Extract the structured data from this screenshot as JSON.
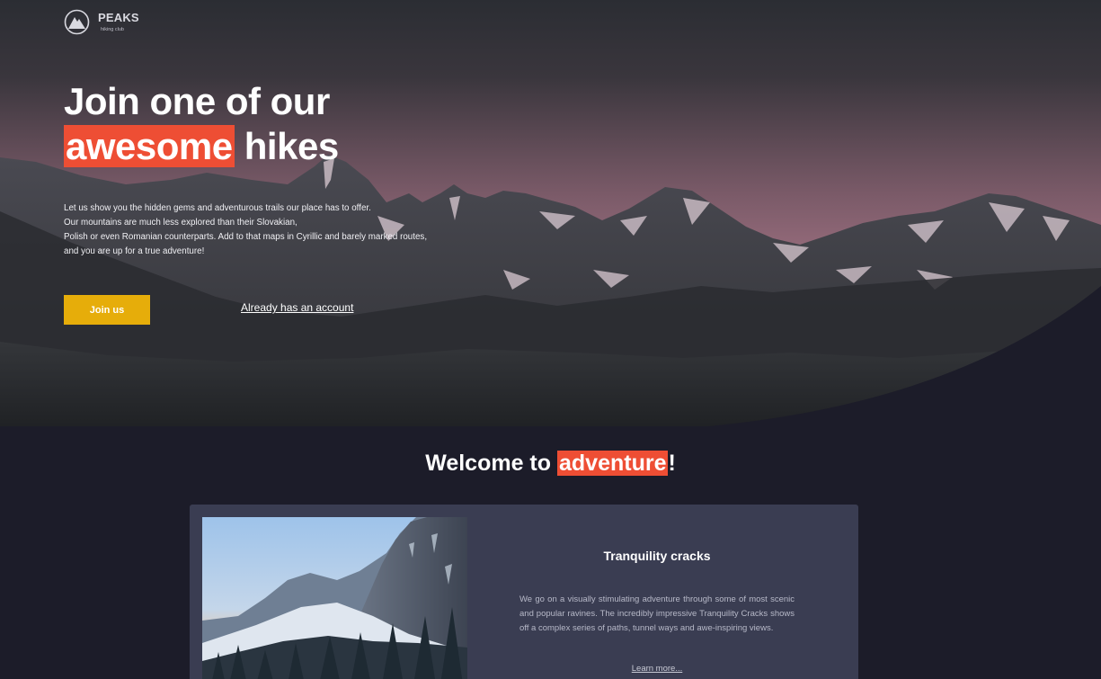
{
  "brand": {
    "name": "PEAKS",
    "tagline": "hiking club",
    "icon": "mountain-logo-icon"
  },
  "hero": {
    "title_line1": "Join one of our",
    "title_highlight": "awesome",
    "title_rest": " hikes",
    "description_lines": [
      "Let us show you the hidden gems and adventurous trails our place has to offer.",
      "Our mountains are much less explored than their Slovakian,",
      "Polish or even Romanian counterparts. Add to that maps in Cyrillic and barely marked routes,",
      "and you are up for a true adventure!"
    ],
    "join_label": "Join us",
    "account_label": "Already has an account"
  },
  "welcome": {
    "prefix": "Welcome to ",
    "highlight": "adventure",
    "suffix": "!"
  },
  "card": {
    "title": "Tranquility cracks",
    "text": "We go on a visually stimulating adventure through some of most scenic and popular ravines. The incredibly impressive Tranquility Cracks shows off a complex series of paths, tunnel ways and awe-inspiring views.",
    "link_label": "Learn more..."
  },
  "colors": {
    "accent": "#ee4e34",
    "button": "#e6ad0a",
    "page_bg": "#1c1c29",
    "card_bg": "#3a3d52"
  }
}
